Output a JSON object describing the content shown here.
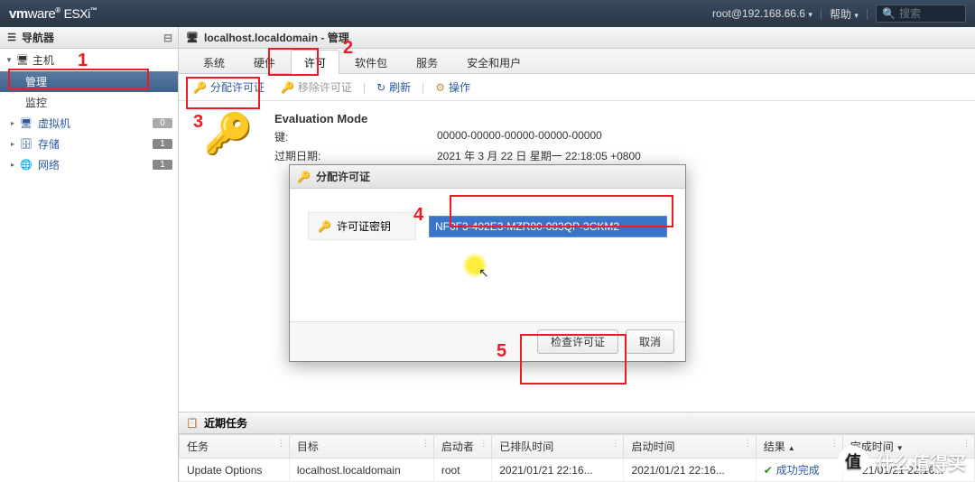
{
  "topbar": {
    "product": "vmware ESXi",
    "user": "root@192.168.66.6",
    "help": "帮助",
    "search_placeholder": "搜索"
  },
  "navigator": {
    "title": "导航器",
    "host": "主机",
    "items": [
      {
        "label": "管理",
        "selected": true
      },
      {
        "label": "监控",
        "selected": false
      }
    ],
    "links": [
      {
        "label": "虚拟机",
        "count": "0",
        "icon": "vm-icon"
      },
      {
        "label": "存储",
        "count": "1",
        "icon": "storage-icon"
      },
      {
        "label": "网络",
        "count": "1",
        "icon": "network-icon"
      }
    ]
  },
  "content": {
    "breadcrumb": "localhost.localdomain - 管理",
    "tabs": [
      "系统",
      "硬件",
      "许可",
      "软件包",
      "服务",
      "安全和用户"
    ],
    "active_tab": 2,
    "actions": {
      "assign": "分配许可证",
      "remove": "移除许可证",
      "refresh": "刷新",
      "ops": "操作"
    },
    "license": {
      "mode": "Evaluation Mode",
      "key_label": "键:",
      "key_value": "00000-00000-00000-00000-00000",
      "expire_label": "过期日期:",
      "expire_value": "2021 年 3 月 22 日 星期一 22:18:05 +0800"
    }
  },
  "dialog": {
    "title": "分配许可证",
    "field_label": "许可证密钥",
    "input_value": "NF0F3-402E3-MZR80-083QP-3CKM2",
    "check_btn": "检查许可证",
    "cancel_btn": "取消"
  },
  "tasks": {
    "title": "近期任务",
    "cols": [
      "任务",
      "目标",
      "启动者",
      "已排队时间",
      "启动时间",
      "结果",
      "完成时间"
    ],
    "row": {
      "task": "Update Options",
      "target": "localhost.localdomain",
      "starter": "root",
      "queued": "2021/01/21 22:16...",
      "started": "2021/01/21 22:16...",
      "result": "成功完成",
      "done": "2021/01/21 22:16..."
    }
  },
  "annotations": {
    "n1": "1",
    "n2": "2",
    "n3": "3",
    "n4": "4",
    "n5": "5"
  },
  "watermark": "什么值得买"
}
